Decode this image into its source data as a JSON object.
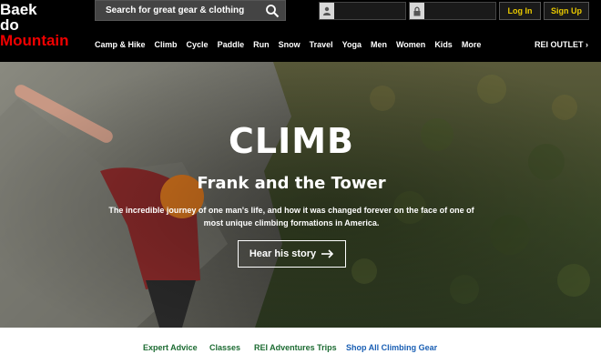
{
  "logo": {
    "line1": "Baek",
    "line2": "do",
    "line3": "Mountain"
  },
  "search": {
    "placeholder": "Search for great gear & clothing",
    "icon": "search-icon"
  },
  "login": {
    "username_value": "",
    "password_value": "",
    "login_label": "Log In",
    "signup_label": "Sign Up"
  },
  "nav": {
    "items": [
      "Camp & Hike",
      "Climb",
      "Cycle",
      "Paddle",
      "Run",
      "Snow",
      "Travel",
      "Yoga",
      "Men",
      "Women",
      "Kids",
      "More"
    ],
    "outlet": "REI OUTLET ›"
  },
  "hero": {
    "title": "CLIMB",
    "subtitle": "Frank and the Tower",
    "description": "The incredible journey of one man's life, and how it was changed forever on the face of one of most unique climbing formations in America.",
    "cta": "Hear his story",
    "cta_icon": "arrow-right-icon"
  },
  "sublinks": [
    "Expert Advice",
    "Classes",
    "REI Adventures Trips",
    "Shop All Climbing Gear"
  ],
  "colors": {
    "header_bg": "#000000",
    "logo_red": "#ee0000",
    "button_text": "#e8c800",
    "link_green": "#1c6b32",
    "link_blue": "#1a5fb4"
  }
}
